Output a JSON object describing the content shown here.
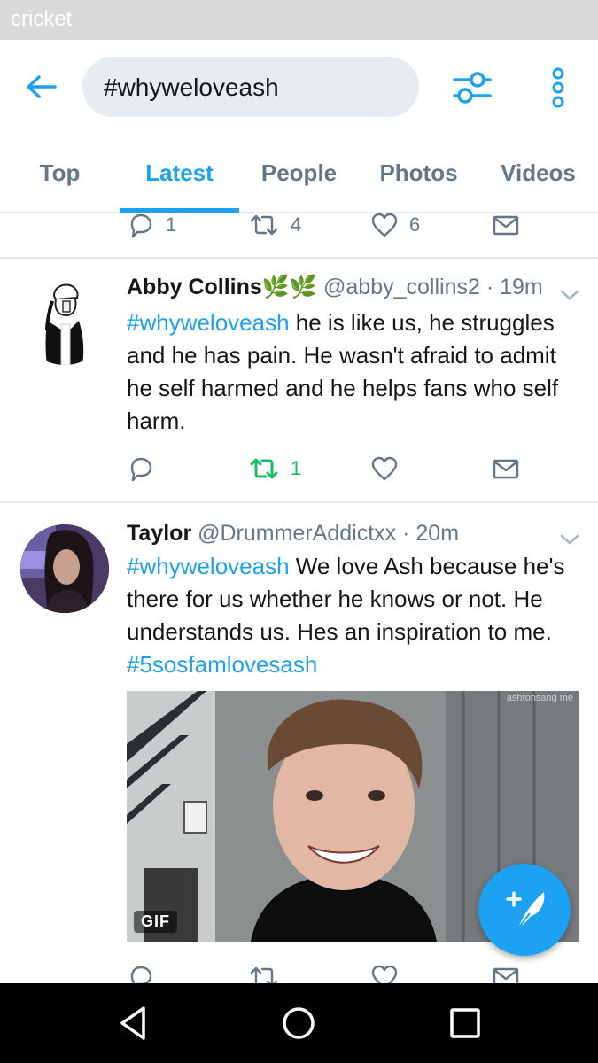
{
  "status_bar": {
    "carrier": "cricket"
  },
  "toolbar": {
    "back_icon": "arrow-left-icon",
    "search_query": "#whyweloveash",
    "filter_icon": "sliders-icon",
    "more_icon": "kebab-menu-icon"
  },
  "tabs": [
    {
      "label": "Top",
      "active": false
    },
    {
      "label": "Latest",
      "active": true
    },
    {
      "label": "People",
      "active": false
    },
    {
      "label": "Photos",
      "active": false
    },
    {
      "label": "Videos",
      "active": false
    }
  ],
  "previous_tweet_actions": {
    "replies": "1",
    "retweets": "4",
    "likes": "6"
  },
  "tweets": [
    {
      "name": "Abby Collins",
      "name_suffix": "🌿🌿",
      "handle": "@abby_collins2",
      "time": "· 19m",
      "hashtag": "#whyweloveash",
      "text": " he is like us, he struggles and he has pain. He wasn't afraid to admit he self harmed and he helps fans who self harm.",
      "replies": "",
      "retweets": "1",
      "retweeted": true,
      "likes": ""
    },
    {
      "name": "Taylor",
      "handle": "@DrummerAddictxx",
      "time": "· 20m",
      "hashtag": "#whyweloveash",
      "text": " We love Ash because he's there for us whether he knows or not. He understands us. Hes an inspiration to me. ",
      "hashtag2": "#5sosfamlovesash",
      "media": {
        "type": "gif",
        "badge": "GIF",
        "watermark": "ashtonsang me"
      }
    }
  ],
  "fab": {
    "icon": "compose-tweet-icon"
  },
  "nav_bar": {
    "back": "triangle-back-icon",
    "home": "circle-home-icon",
    "recents": "square-recents-icon"
  },
  "colors": {
    "accent": "#1da1f2",
    "retweet_green": "#17bf63",
    "muted": "#657786"
  }
}
